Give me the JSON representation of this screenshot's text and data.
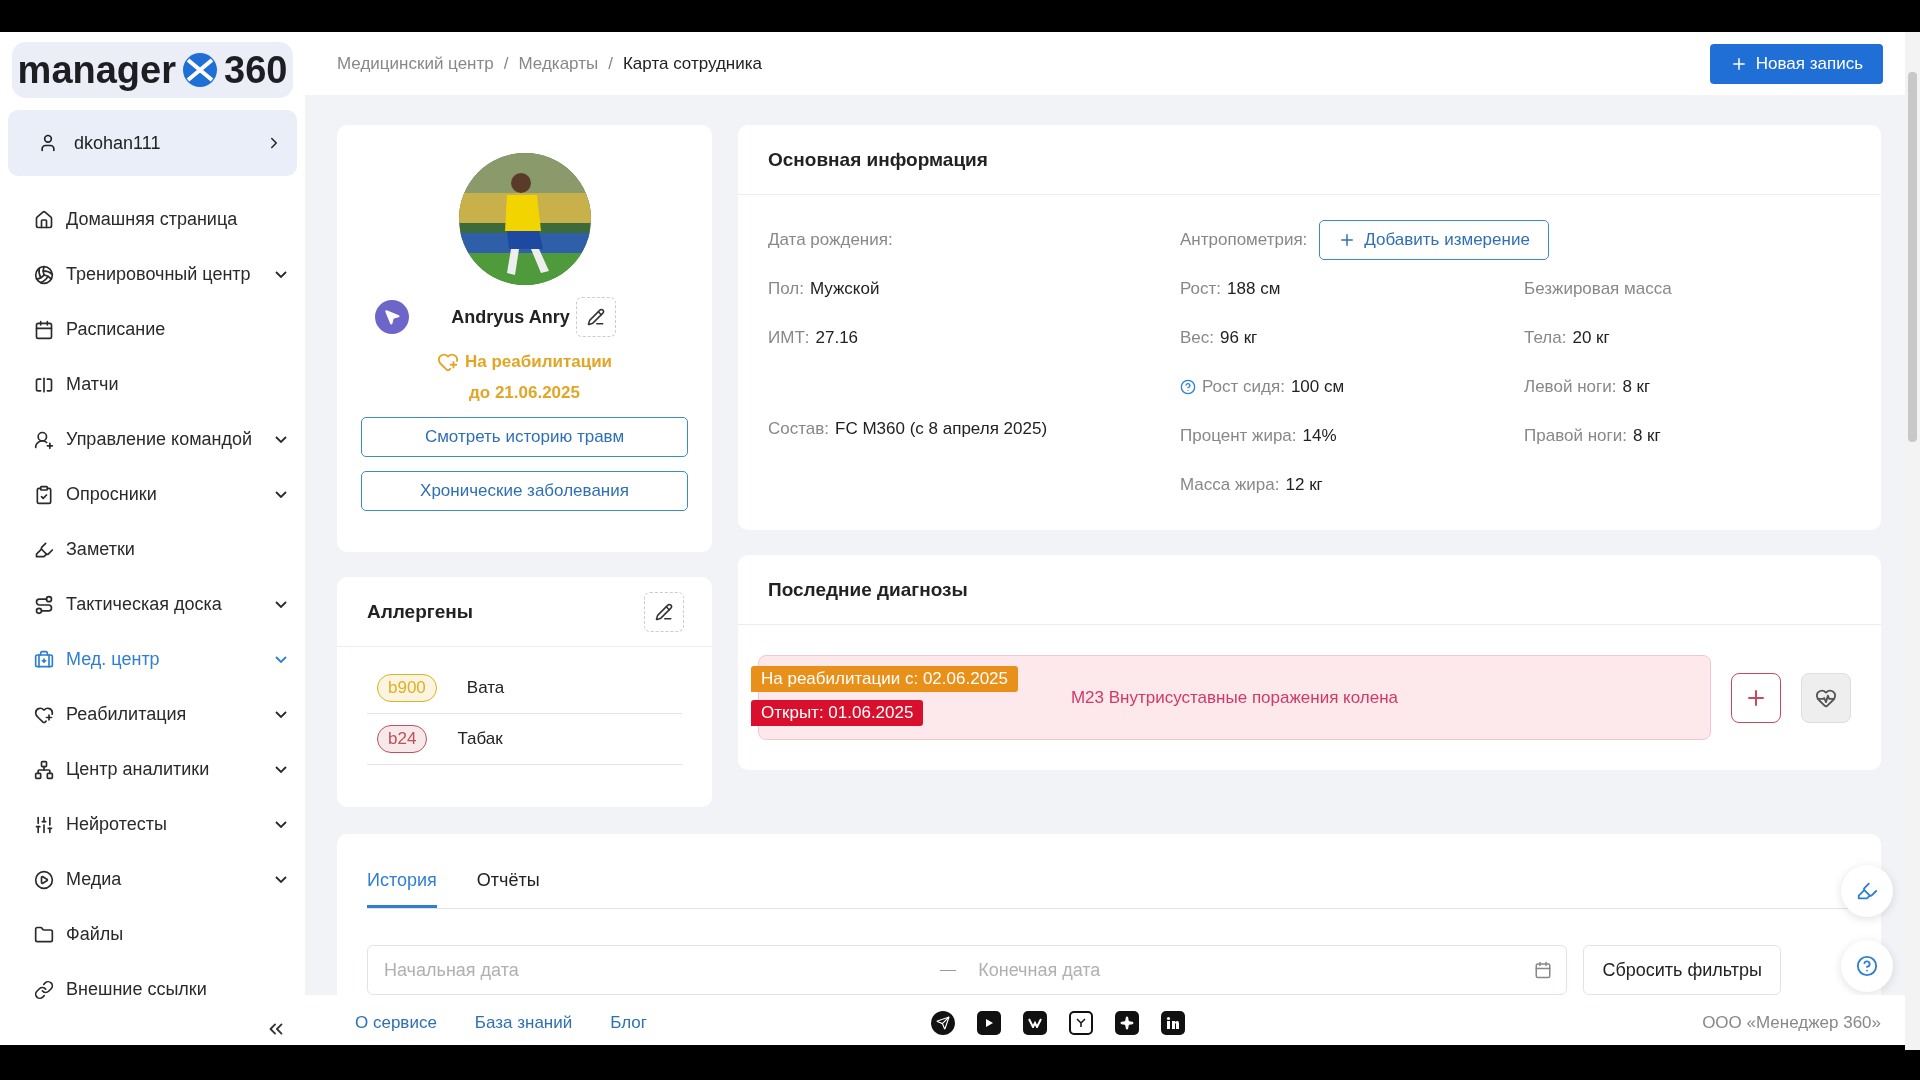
{
  "logo": {
    "word": "manager",
    "number": "360"
  },
  "user": {
    "name": "dkohan111"
  },
  "nav": [
    {
      "label": "Домашняя страница",
      "kind": "home",
      "expandable": false,
      "selected": false
    },
    {
      "label": "Тренировочный центр",
      "kind": "ball",
      "expandable": true,
      "selected": false
    },
    {
      "label": "Расписание",
      "kind": "calendar",
      "expandable": false,
      "selected": false
    },
    {
      "label": "Матчи",
      "kind": "board",
      "expandable": false,
      "selected": false
    },
    {
      "label": "Управление командой",
      "kind": "team",
      "expandable": true,
      "selected": false
    },
    {
      "label": "Опросники",
      "kind": "survey",
      "expandable": true,
      "selected": false
    },
    {
      "label": "Заметки",
      "kind": "notes",
      "expandable": false,
      "selected": false
    },
    {
      "label": "Тактическая доска",
      "kind": "tactic",
      "expandable": true,
      "selected": false
    },
    {
      "label": "Мед. центр",
      "kind": "med",
      "expandable": true,
      "selected": true
    },
    {
      "label": "Реабилитация",
      "kind": "rehab",
      "expandable": true,
      "selected": false
    },
    {
      "label": "Центр аналитики",
      "kind": "analytics",
      "expandable": true,
      "selected": false
    },
    {
      "label": "Нейротесты",
      "kind": "neuro",
      "expandable": true,
      "selected": false
    },
    {
      "label": "Медиа",
      "kind": "media",
      "expandable": true,
      "selected": false
    },
    {
      "label": "Файлы",
      "kind": "files",
      "expandable": false,
      "selected": false
    },
    {
      "label": "Внешние ссылки",
      "kind": "links",
      "expandable": false,
      "selected": false
    }
  ],
  "breadcrumbs": [
    "Медицинский центр",
    "Медкарты",
    "Карта сотрудника"
  ],
  "breadcrumb_separator": "/",
  "new_button": "Новая запись",
  "profile": {
    "avatar": {
      "kind": "picture"
    },
    "name": "Andryus Anry",
    "status": "На реабилитации",
    "status_until": "до 21.06.2025",
    "buttons": [
      "Смотреть историю травм",
      "Хронические заболевания"
    ]
  },
  "allergens": {
    "title": "Аллергены",
    "items": [
      {
        "code": "b900",
        "name": "Вата",
        "color": "#e0b020"
      },
      {
        "code": "b24",
        "name": "Табак",
        "color": "#c0505a"
      }
    ]
  },
  "info": {
    "title": "Основная информация",
    "add_button": "Добавить измерение",
    "col1": [
      {
        "label": "Дата рождения:"
      },
      {
        "label": "Пол:",
        "value": "Мужской"
      },
      {
        "label": "ИМТ:",
        "value": "27.16"
      },
      {
        "label": "Состав:",
        "value": "FC M360 (с 8 апреля 2025)"
      }
    ],
    "col2": [
      {
        "label": "Антропометрия:"
      },
      {
        "label": "Рост:",
        "value": "188 см"
      },
      {
        "label": "Вес:",
        "value": "96 кг"
      },
      {
        "label": "Рост сидя:",
        "value": "100 см",
        "help": true
      },
      {
        "label": "Процент жира:",
        "value": "14%"
      },
      {
        "label": "Масса жира:",
        "value": "12 кг"
      }
    ],
    "col3": [
      {
        "label": "Безжировая масса"
      },
      {
        "label": "Тела:",
        "value": "20 кг"
      },
      {
        "label": "Левой ноги:",
        "value": "8 кг"
      },
      {
        "label": "Правой ноги:",
        "value": "8 кг"
      }
    ]
  },
  "diagnoses": {
    "title": "Последние диагнозы",
    "items": [
      {
        "tags": [
          {
            "text": "На реабилитации с: 02.06.2025",
            "color": "#e8901a"
          },
          {
            "text": "Открыт: 01.06.2025",
            "color": "#d8102e"
          }
        ],
        "text": "M23 Внутрисуставные поражения колена"
      }
    ]
  },
  "tabs": [
    {
      "label": "История",
      "selected": true
    },
    {
      "label": "Отчёты",
      "selected": false
    }
  ],
  "filters": {
    "start_placeholder": "Начальная дата",
    "end_placeholder": "Конечная дата",
    "reset": "Сбросить фильтры"
  },
  "footer": {
    "links": [
      "О сервисе",
      "База знаний",
      "Блог"
    ],
    "copyright": "ООО «Менеджер 360»"
  }
}
